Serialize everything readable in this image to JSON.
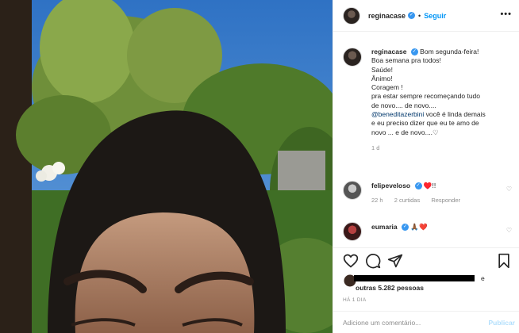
{
  "post": {
    "username": "reginacase",
    "follow_label": "Seguir",
    "separator": "•",
    "more_label": "•••"
  },
  "caption": {
    "username": "reginacase",
    "lines": [
      "Bom segunda-feira!",
      "Boa semana pra todos!",
      "Saúde!",
      "Ânimo!",
      "Coragem !",
      "pra estar sempre recomeçando tudo",
      "de novo.... de novo....",
      "@beneditazerbini",
      "você é linda demais",
      "e eu preciso dizer que eu te amo de",
      "novo ... e de novo....♡"
    ],
    "time": "1 d"
  },
  "comments": [
    {
      "username": "felipeveloso",
      "text": "♥️!!",
      "time": "22 h",
      "likes": "2 curtidas",
      "reply": "Responder"
    },
    {
      "username": "eumaria",
      "text": "🙏🏾❤️",
      "time": "",
      "likes": "",
      "reply": ""
    }
  ],
  "likes": {
    "suffix": "e",
    "others": "outras 5.282 pessoas"
  },
  "date": "HÁ 1 DIA",
  "add_comment": {
    "placeholder": "Adicione um comentário...",
    "publish": "Publicar"
  },
  "colors": {
    "accent": "#0095f6",
    "verified": "#3897f0",
    "muted": "#8e8e8e",
    "sky": "#3a7ac6"
  },
  "icons": [
    "heart-icon",
    "comment-icon",
    "share-icon",
    "bookmark-icon",
    "more-options-icon",
    "verified-icon"
  ]
}
